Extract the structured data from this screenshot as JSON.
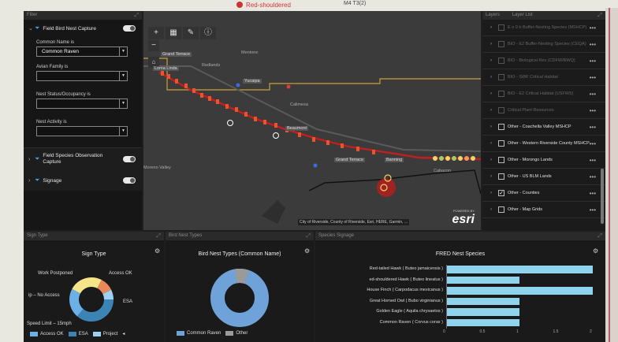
{
  "background": {
    "legend_label": "Red-shouldered",
    "route_tag": "M4 T3(2)"
  },
  "filter_panel": {
    "title": "Filter",
    "groups": [
      {
        "label": "Field Bird Nest Capture",
        "toggle_on": true
      },
      {
        "label": "Field Species Observation Capture",
        "toggle_on": true
      },
      {
        "label": "Signage",
        "toggle_on": true
      }
    ],
    "fields": [
      {
        "label": "Common Name is",
        "value": "Common Raven"
      },
      {
        "label": "Avian Family is",
        "value": ""
      },
      {
        "label": "Nest Status/Occupancy is",
        "value": ""
      },
      {
        "label": "Nest Activity is",
        "value": ""
      }
    ]
  },
  "map": {
    "tools": [
      "+",
      "▦",
      "✎",
      "ⓘ"
    ],
    "zoom_out": "−",
    "home": "⌂",
    "labels": [
      "Redlands",
      "Loma Linda",
      "Mentone",
      "Yucaipa",
      "Calimesa",
      "Beaumont",
      "Banning",
      "Cabazon",
      "Grand Terrace",
      "Moreno Valley"
    ],
    "attribution": "City of Riverside, County of Riverside, Esri, HERE, Garmin, ...",
    "brand": "esri",
    "brand_small": "POWERED BY"
  },
  "layer_list": {
    "title": "Layers",
    "subtitle": "Layer List",
    "items": [
      {
        "label": "E o 0 b Buffer-Nesting Species (MSHCP)",
        "checked": false,
        "faded": true
      },
      {
        "label": "BIO - E2 Buffer-Nesting Species (CEQA)",
        "checked": false,
        "faded": true
      },
      {
        "label": "BIO - Biological Res (CDFW/RWQ)",
        "checked": false,
        "faded": true
      },
      {
        "label": "BIO - SWF Critical Habitat",
        "checked": false,
        "faded": true
      },
      {
        "label": "BIO - E2 Critical Habitat (USFWS)",
        "checked": false,
        "faded": true
      },
      {
        "label": "Critical Plant Resources",
        "checked": false,
        "faded": true
      },
      {
        "label": "Other - Coachella Valley MSHCP",
        "checked": false,
        "faded": false
      },
      {
        "label": "Other - Western Riverside County MSHCP",
        "checked": false,
        "faded": false
      },
      {
        "label": "Other - Morongo Lands",
        "checked": false,
        "faded": false
      },
      {
        "label": "Other - US BLM Lands",
        "checked": false,
        "faded": false
      },
      {
        "label": "Other - Counties",
        "checked": true,
        "faded": false
      },
      {
        "label": "Other - Map Grids",
        "checked": false,
        "faded": false
      }
    ]
  },
  "sign_type": {
    "header": "Sign Type",
    "title": "Sign Type",
    "slice_labels": [
      "Work Postponed",
      "Access OK",
      "ESA",
      "ip – No Access",
      "Speed Limit – 15mph"
    ],
    "legend": [
      "Access OK",
      "ESA",
      "Project"
    ],
    "colors": {
      "access_ok": "#6bb0e6",
      "esa": "#3c83b6",
      "project": "#f2d36b",
      "no_access": "#f6e48a",
      "postponed": "#e9895a",
      "speed": "#9ed0f2"
    }
  },
  "nest_types": {
    "header": "Bird Nest Types",
    "title": "Bird Nest Types (Common Name)",
    "legend": [
      "Common Raven",
      "Other"
    ],
    "colors": {
      "common_raven": "#6ea2d8",
      "other": "#9a9a9a"
    }
  },
  "chart_data": {
    "type": "bar",
    "title": "FRED Nest Species",
    "categories": [
      "Red-tailed Hawk ( Buteo jamaicensis )",
      "ed-shouldered Hawk ( Buteo lineatus )",
      "House Finch ( Carpodacus mexicanus )",
      "Great Horned Owl ( Bubo virginianus )",
      "Golden Eagle ( Aquila chrysaetos )",
      "Common Raven ( Corvus corax )"
    ],
    "values": [
      2,
      1,
      2,
      1,
      1,
      1
    ],
    "xlim": [
      0,
      2
    ],
    "xticks": [
      "0",
      "0.5",
      "1",
      "1.5",
      "2"
    ],
    "bar_color": "#8fd3ec",
    "header": "Species Signage"
  }
}
